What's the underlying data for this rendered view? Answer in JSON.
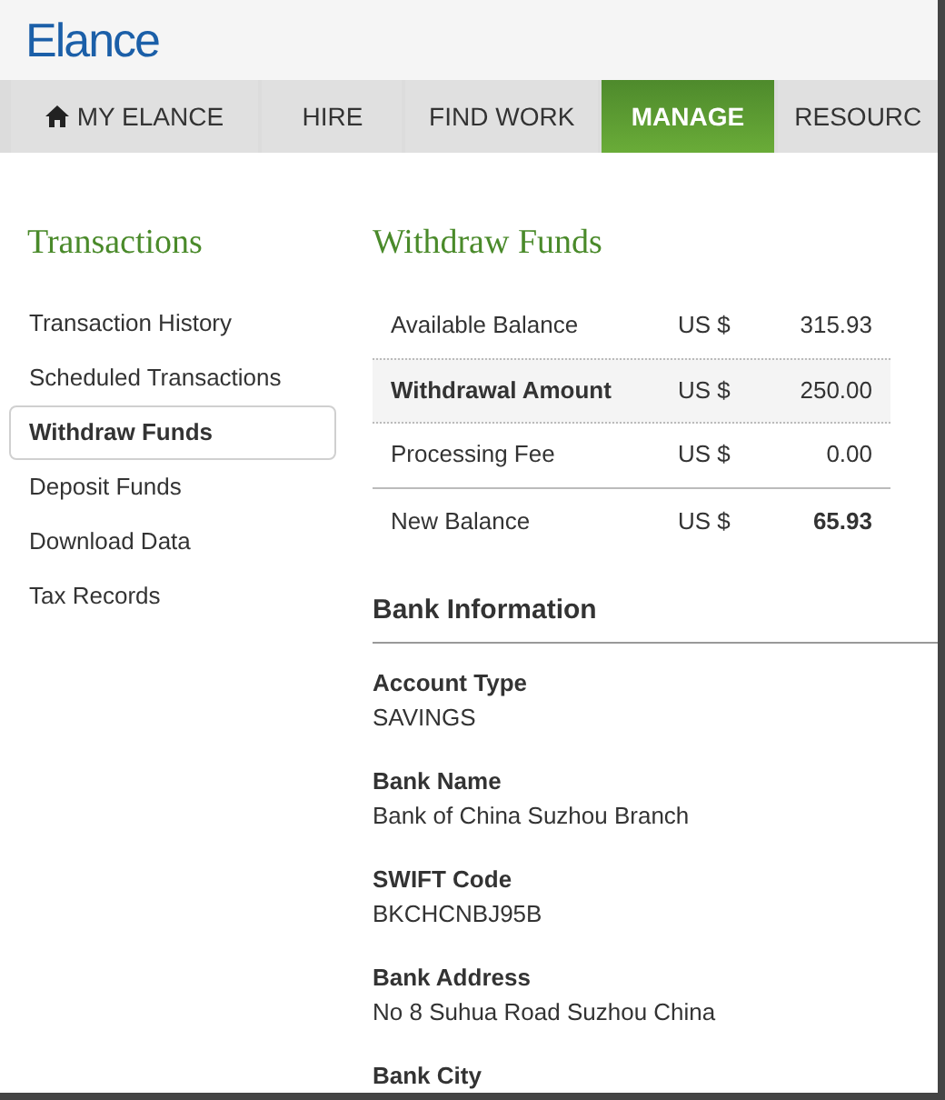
{
  "logo": "Elance",
  "nav_tabs": [
    {
      "label": "MY ELANCE",
      "selected": false
    },
    {
      "label": "HIRE",
      "selected": false
    },
    {
      "label": "FIND WORK",
      "selected": false
    },
    {
      "label": "MANAGE",
      "selected": true
    },
    {
      "label": "RESOURC",
      "selected": false
    }
  ],
  "sidebar": {
    "title": "Transactions",
    "items": [
      {
        "label": "Transaction History",
        "selected": false
      },
      {
        "label": "Scheduled Transactions",
        "selected": false
      },
      {
        "label": "Withdraw Funds",
        "selected": true
      },
      {
        "label": "Deposit Funds",
        "selected": false
      },
      {
        "label": "Download Data",
        "selected": false
      },
      {
        "label": "Tax Records",
        "selected": false
      }
    ]
  },
  "main": {
    "title": "Withdraw Funds",
    "summary_rows": [
      {
        "kind": "plain",
        "label": "Available Balance",
        "currency": "US $",
        "amount": "315.93"
      },
      {
        "kind": "amount",
        "label": "Withdrawal Amount",
        "currency": "US $",
        "amount": "250.00"
      },
      {
        "kind": "fee",
        "label": "Processing Fee",
        "currency": "US $",
        "amount": "0.00"
      },
      {
        "kind": "total",
        "label": "New Balance",
        "currency": "US $",
        "amount": "65.93"
      }
    ],
    "bank_heading": "Bank Information",
    "bank_fields": [
      {
        "label": "Account Type",
        "value": "SAVINGS"
      },
      {
        "label": "Bank Name",
        "value": "Bank of China Suzhou Branch"
      },
      {
        "label": "SWIFT Code",
        "value": "BKCHCNBJ95B"
      },
      {
        "label": "Bank Address",
        "value": "No 8 Suhua Road Suzhou China"
      },
      {
        "label": "Bank City"
      }
    ]
  }
}
